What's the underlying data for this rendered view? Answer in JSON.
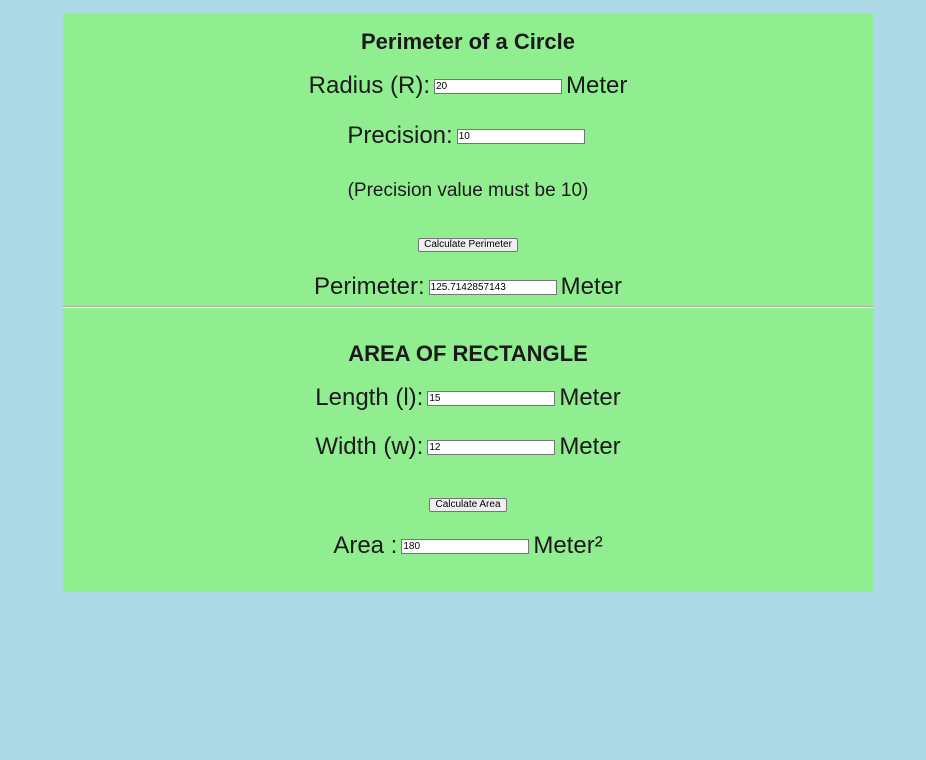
{
  "circle": {
    "title": "Perimeter of a Circle",
    "radius_label": "Radius (R):",
    "radius_value": "20",
    "radius_unit": "Meter",
    "precision_label": "Precision:",
    "precision_value": "10",
    "precision_note": "(Precision value must be 10)",
    "button_label": "Calculate Perimeter",
    "perimeter_label": "Perimeter:",
    "perimeter_value": "125.7142857143",
    "perimeter_unit": "Meter"
  },
  "rectangle": {
    "title": "AREA OF RECTANGLE",
    "length_label": "Length (l):",
    "length_value": "15",
    "length_unit": "Meter",
    "width_label": "Width (w):",
    "width_value": "12",
    "width_unit": "Meter",
    "button_label": "Calculate Area",
    "area_label": "Area :",
    "area_value": "180",
    "area_unit": "Meter²"
  },
  "colors": {
    "page_background": "#add8e6",
    "panel_background": "#90ee90"
  }
}
